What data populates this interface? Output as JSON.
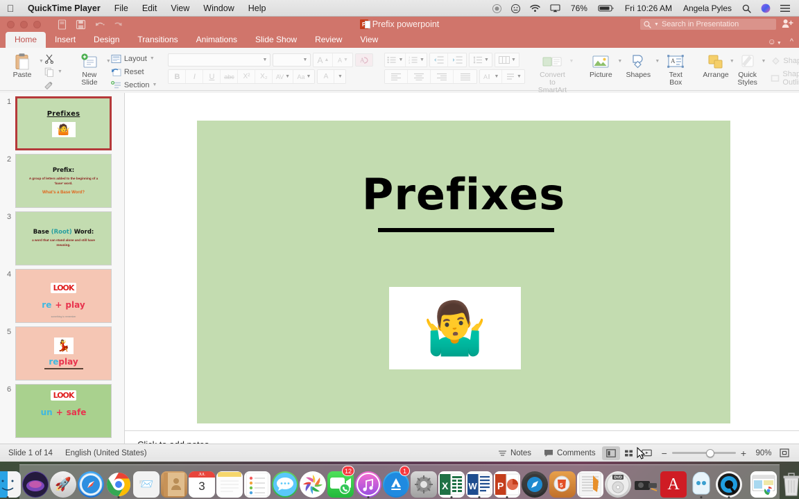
{
  "menubar": {
    "apple": "apple-logo",
    "items": [
      {
        "label": "QuickTime Player",
        "bold": true
      },
      {
        "label": "File",
        "bold": false
      },
      {
        "label": "Edit",
        "bold": false
      },
      {
        "label": "View",
        "bold": false
      },
      {
        "label": "Window",
        "bold": false
      },
      {
        "label": "Help",
        "bold": false
      }
    ],
    "status": {
      "battery_pct": "76%",
      "datetime": "Fri 10:26 AM",
      "user": "Angela Pyles",
      "icons": [
        "screen-record-icon",
        "dnd-icon",
        "wifi-icon",
        "airplay-icon",
        "battery-icon",
        "search-icon",
        "siri-icon",
        "notification-center-icon"
      ]
    }
  },
  "window": {
    "document_title": "Prefix powerpoint",
    "traffic_lights": [
      "close",
      "minimize",
      "zoom"
    ],
    "quick_access": [
      "save-as-icon",
      "save-icon",
      "undo-icon",
      "redo-icon"
    ],
    "search_placeholder": "Search in Presentation",
    "share_icon": "person-add-icon",
    "smiley_icon": "smiley-feedback-icon",
    "collapse_icon": "collapse-ribbon-icon"
  },
  "ribbon": {
    "tabs": [
      {
        "label": "Home",
        "active": true
      },
      {
        "label": "Insert",
        "active": false
      },
      {
        "label": "Design",
        "active": false
      },
      {
        "label": "Transitions",
        "active": false
      },
      {
        "label": "Animations",
        "active": false
      },
      {
        "label": "Slide Show",
        "active": false
      },
      {
        "label": "Review",
        "active": false
      },
      {
        "label": "View",
        "active": false
      }
    ],
    "clipboard": {
      "paste_label": "Paste",
      "cut_icon": "scissors-icon",
      "copy_icon": "copy-icon",
      "format_painter_icon": "format-painter-icon"
    },
    "slides": {
      "new_slide_label": "New\nSlide",
      "new_slide_line1": "New",
      "new_slide_line2": "Slide",
      "layout_label": "Layout",
      "reset_label": "Reset",
      "section_label": "Section"
    },
    "font": {
      "font_name": "",
      "font_size": "",
      "grow_font": "A",
      "shrink_font": "A",
      "clear_format": "clear-formatting-icon",
      "bold": "B",
      "italic": "I",
      "underline": "U",
      "strikethrough": "abc",
      "superscript": "X²",
      "subscript": "X₂",
      "char_spacing": "AV",
      "change_case": "Aa",
      "font_color": "A"
    },
    "paragraph": {
      "bullets": "bullets-icon",
      "numbering": "numbering-icon",
      "decrease_indent": "decrease-indent-icon",
      "increase_indent": "increase-indent-icon",
      "line_spacing": "line-spacing-icon",
      "columns": "columns-icon",
      "align_left": "align-left-icon",
      "align_center": "align-center-icon",
      "align_right": "align-right-icon",
      "justify": "justify-icon",
      "text_direction": "text-direction-icon",
      "align_text": "align-text-icon"
    },
    "insert": {
      "smartart_line1": "Convert to",
      "smartart_line2": "SmartArt",
      "picture_label": "Picture",
      "shapes_label": "Shapes",
      "textbox_line1": "Text",
      "textbox_line2": "Box"
    },
    "drawing": {
      "arrange_label": "Arrange",
      "quick_styles_line1": "Quick",
      "quick_styles_line2": "Styles",
      "shape_fill_label": "Shape Fill",
      "shape_outline_label": "Shape Outline"
    }
  },
  "slides_panel": {
    "slides": [
      {
        "num": "1",
        "selected": true,
        "bg": "#c3dcb0",
        "kind": "title",
        "title": "Prefixes",
        "image": "shrug-emoji"
      },
      {
        "num": "2",
        "selected": false,
        "bg": "#c3dcb0",
        "kind": "definition",
        "heading": "Prefix:",
        "body": "A group of letters added to the beginning of a 'base' word.",
        "question": "What's a Base Word?"
      },
      {
        "num": "3",
        "selected": false,
        "bg": "#c3dcb0",
        "kind": "definition2",
        "heading_a": "Base ",
        "heading_b": "(Root)",
        "heading_c": " Word:",
        "body": "a word that can stand alone and still have meaning."
      },
      {
        "num": "4",
        "selected": false,
        "bg": "#f5c6b4",
        "kind": "equation",
        "look": "LOOK",
        "left": "re",
        "plus": "+",
        "right": "play",
        "footer": "something to remember"
      },
      {
        "num": "5",
        "selected": false,
        "bg": "#f5c6b4",
        "kind": "word",
        "pic": "girl-drinking",
        "left": "re",
        "right": "play"
      },
      {
        "num": "6",
        "selected": false,
        "bg": "#a9d18e",
        "kind": "equation",
        "look": "LOOK",
        "left": "un",
        "plus": "+",
        "right": "safe"
      }
    ]
  },
  "editor": {
    "slide": {
      "background": "#c3dcb0",
      "title": "Prefixes",
      "image_alt": "shrug-emoji"
    },
    "notes_placeholder": "Click to add notes"
  },
  "status_bar": {
    "slide_count": "Slide 1 of 14",
    "language": "English (United States)",
    "notes_label": "Notes",
    "comments_label": "Comments",
    "views": [
      "normal-view-icon",
      "slide-sorter-icon",
      "slideshow-view-icon"
    ],
    "zoom_out": "−",
    "zoom_in": "+",
    "zoom_level": "90%",
    "fit_icon": "fit-slide-icon"
  },
  "dock": {
    "items": [
      {
        "name": "finder",
        "running": true,
        "badge": ""
      },
      {
        "name": "siri",
        "running": false,
        "badge": ""
      },
      {
        "name": "launchpad",
        "running": false,
        "badge": ""
      },
      {
        "name": "safari",
        "running": false,
        "badge": ""
      },
      {
        "name": "chrome",
        "running": true,
        "badge": ""
      },
      {
        "name": "mail",
        "running": false,
        "badge": ""
      },
      {
        "name": "contacts",
        "running": false,
        "badge": ""
      },
      {
        "name": "calendar",
        "running": false,
        "badge": "3"
      },
      {
        "name": "notes",
        "running": false,
        "badge": ""
      },
      {
        "name": "reminders",
        "running": false,
        "badge": ""
      },
      {
        "name": "messages",
        "running": false,
        "badge": ""
      },
      {
        "name": "photos",
        "running": false,
        "badge": ""
      },
      {
        "name": "facetime",
        "running": false,
        "badge": "12"
      },
      {
        "name": "itunes",
        "running": true,
        "badge": ""
      },
      {
        "name": "app-store",
        "running": false,
        "badge": "1"
      },
      {
        "name": "system-preferences",
        "running": false,
        "badge": ""
      },
      {
        "name": "excel",
        "running": true,
        "badge": ""
      },
      {
        "name": "word",
        "running": true,
        "badge": ""
      },
      {
        "name": "powerpoint",
        "running": true,
        "badge": ""
      },
      {
        "name": "safari-alt",
        "running": false,
        "badge": ""
      },
      {
        "name": "html5",
        "running": false,
        "badge": ""
      },
      {
        "name": "textedit",
        "running": false,
        "badge": ""
      },
      {
        "name": "dvd-player",
        "running": false,
        "badge": ""
      },
      {
        "name": "image-capture",
        "running": false,
        "badge": ""
      },
      {
        "name": "adobe-reader",
        "running": false,
        "badge": ""
      },
      {
        "name": "photo-booth",
        "running": true,
        "badge": ""
      },
      {
        "name": "quicktime-player",
        "running": true,
        "badge": ""
      }
    ],
    "downloads_stack": "downloads-stack",
    "trash": "trash-icon"
  }
}
